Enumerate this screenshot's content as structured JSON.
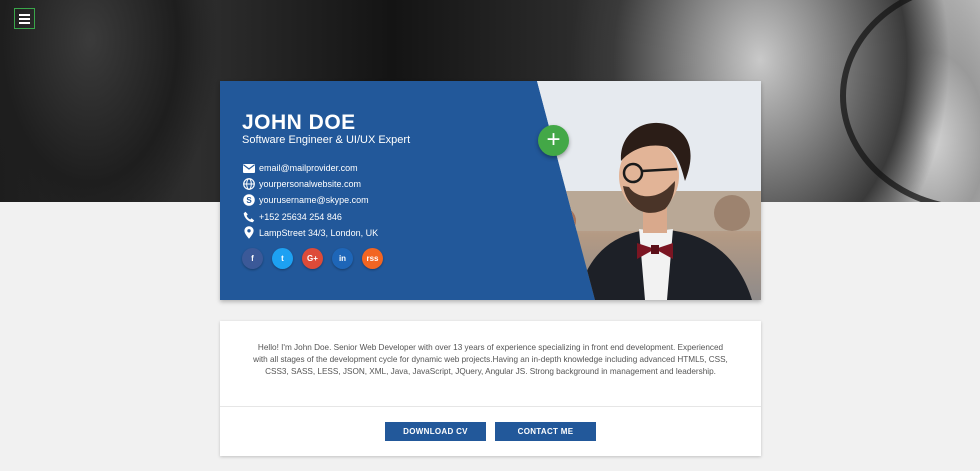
{
  "profile": {
    "name": "JOHN DOE",
    "title": "Software Engineer & UI/UX Expert",
    "contacts": [
      {
        "icon": "email-icon",
        "text": "email@mailprovider.com"
      },
      {
        "icon": "globe-icon",
        "text": "yourpersonalwebsite.com"
      },
      {
        "icon": "skype-icon",
        "text": "yourusername@skype.com"
      },
      {
        "icon": "phone-icon",
        "text": "+152 25634 254 846"
      },
      {
        "icon": "location-pin-icon",
        "text": "LampStreet 34/3, London, UK"
      }
    ],
    "socials": [
      {
        "name": "facebook",
        "label": "f",
        "color": "#3b5998"
      },
      {
        "name": "twitter",
        "label": "t",
        "color": "#1da1f2"
      },
      {
        "name": "google-plus",
        "label": "G+",
        "color": "#dd4b39"
      },
      {
        "name": "linkedin",
        "label": "in",
        "color": "#1e66b8"
      },
      {
        "name": "rss",
        "label": "rss",
        "color": "#f26522"
      }
    ],
    "add_button_label": "+"
  },
  "about": {
    "bio": "Hello! I'm John Doe. Senior Web Developer with over 13 years of experience specializing in front end development. Experienced with all stages of the development cycle for dynamic web projects.Having an in-depth knowledge including advanced HTML5, CSS, CSS3, SASS, LESS, JSON, XML, Java, JavaScript, JQuery, Angular JS. Strong background in management and leadership."
  },
  "actions": {
    "download_label": "DOWNLOAD CV",
    "contact_label": "CONTACT ME"
  },
  "colors": {
    "brand_blue": "#22589a",
    "accent_green": "#43a847"
  }
}
